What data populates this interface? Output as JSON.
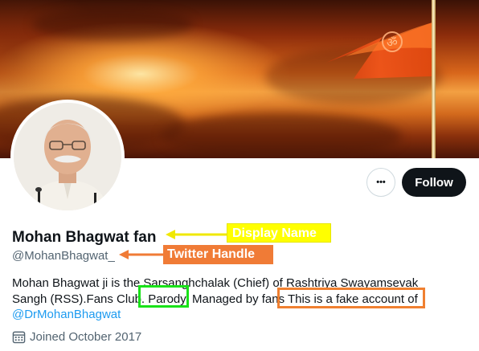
{
  "profile": {
    "display_name": "Mohan Bhagwat fan",
    "handle": "@MohanBhagwat_",
    "bio_line1": "Mohan Bhagwat ji is the Sarsanghchalak (Chief) of Rashtriya Swayamsevak",
    "bio_line2_before": "Sangh (RSS).Fans Club. ",
    "bio_parody": "Parody.",
    "bio_line2_after": " Managed by fans This is a fake account of",
    "bio_mention": "@DrMohanBhagwat",
    "joined": "Joined October 2017"
  },
  "actions": {
    "more_label": "•••",
    "follow_label": "Follow"
  },
  "annotations": {
    "display_name_tag": "Display Name",
    "handle_tag": "Twitter Handle"
  },
  "icons": {
    "banner": "saffron-flag-sunset-banner",
    "avatar": "profile-photo",
    "more": "more-options-icon",
    "calendar": "calendar-icon"
  },
  "colors": {
    "follow_bg": "#0f1419",
    "link": "#1d9bf0",
    "secondary_text": "#536471",
    "display_tag": "#ffff00",
    "handle_tag": "#f07b36",
    "parody_box": "#19e219",
    "fake_box": "#f08030"
  }
}
